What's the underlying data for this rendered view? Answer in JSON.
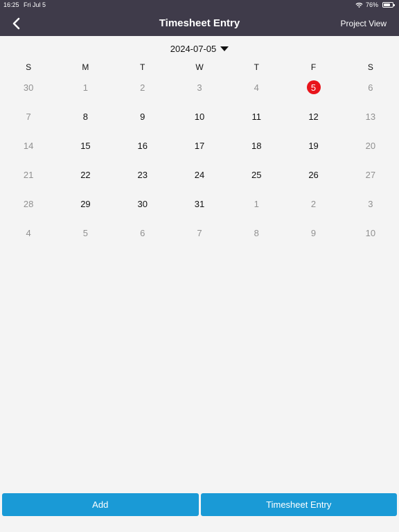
{
  "status": {
    "time": "16:25",
    "date": "Fri Jul 5",
    "battery": "76%",
    "battery_level": 0.76
  },
  "nav": {
    "title": "Timesheet Entry",
    "right_label": "Project View"
  },
  "date_picker": {
    "value": "2024-07-05"
  },
  "weekdays": [
    "S",
    "M",
    "T",
    "W",
    "T",
    "F",
    "S"
  ],
  "calendar": {
    "weeks": [
      [
        {
          "label": "30",
          "muted": true
        },
        {
          "label": "1",
          "muted": true
        },
        {
          "label": "2",
          "muted": true
        },
        {
          "label": "3",
          "muted": true
        },
        {
          "label": "4",
          "muted": true
        },
        {
          "label": "5",
          "selected": true
        },
        {
          "label": "6",
          "muted": true
        }
      ],
      [
        {
          "label": "7",
          "muted": true
        },
        {
          "label": "8"
        },
        {
          "label": "9"
        },
        {
          "label": "10"
        },
        {
          "label": "11"
        },
        {
          "label": "12"
        },
        {
          "label": "13",
          "muted": true
        }
      ],
      [
        {
          "label": "14",
          "muted": true
        },
        {
          "label": "15"
        },
        {
          "label": "16"
        },
        {
          "label": "17"
        },
        {
          "label": "18"
        },
        {
          "label": "19"
        },
        {
          "label": "20",
          "muted": true
        }
      ],
      [
        {
          "label": "21",
          "muted": true
        },
        {
          "label": "22"
        },
        {
          "label": "23"
        },
        {
          "label": "24"
        },
        {
          "label": "25"
        },
        {
          "label": "26"
        },
        {
          "label": "27",
          "muted": true
        }
      ],
      [
        {
          "label": "28",
          "muted": true
        },
        {
          "label": "29"
        },
        {
          "label": "30"
        },
        {
          "label": "31"
        },
        {
          "label": "1",
          "muted": true
        },
        {
          "label": "2",
          "muted": true
        },
        {
          "label": "3",
          "muted": true
        }
      ],
      [
        {
          "label": "4",
          "muted": true
        },
        {
          "label": "5",
          "muted": true
        },
        {
          "label": "6",
          "muted": true
        },
        {
          "label": "7",
          "muted": true
        },
        {
          "label": "8",
          "muted": true
        },
        {
          "label": "9",
          "muted": true
        },
        {
          "label": "10",
          "muted": true
        }
      ]
    ]
  },
  "bottom": {
    "add_label": "Add",
    "entry_label": "Timesheet Entry"
  },
  "colors": {
    "header_bg": "#3f3b4a",
    "accent": "#1a9ad6",
    "selected": "#e8141b"
  },
  "icons": {
    "back": "chevron-left-icon",
    "wifi": "wifi-icon",
    "battery": "battery-icon",
    "dropdown": "caret-down-icon"
  }
}
